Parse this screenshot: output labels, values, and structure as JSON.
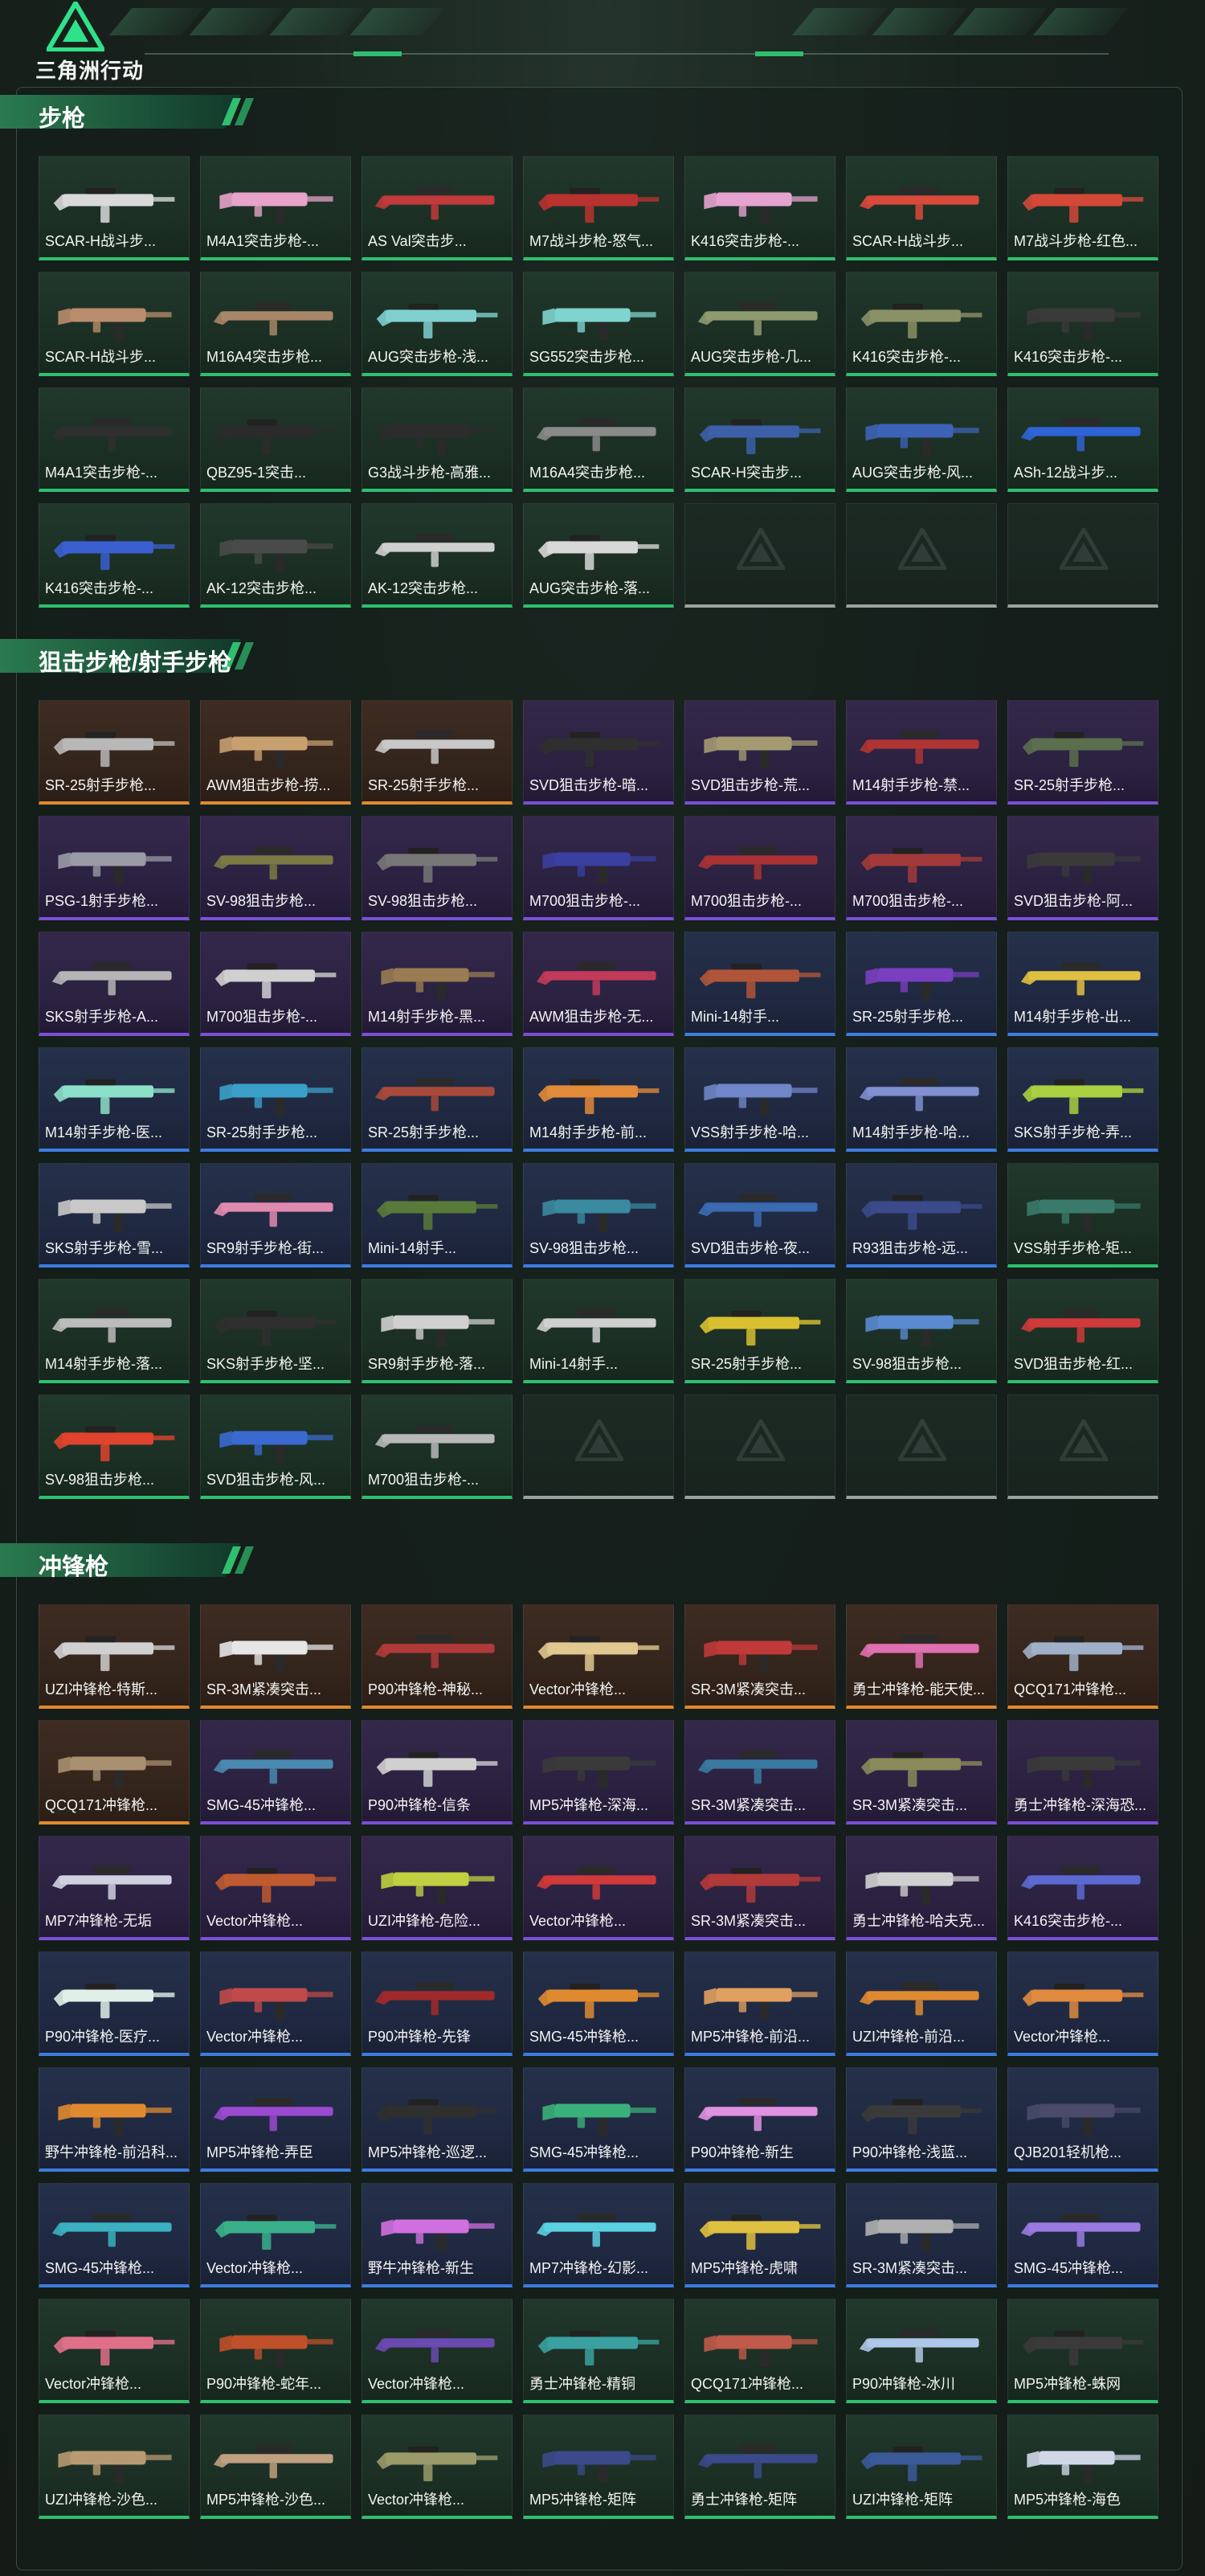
{
  "app": {
    "logo_text": "三角洲行动"
  },
  "colors": {
    "green": "#2fbf6e",
    "purple": "#7b4fd6",
    "orange": "#e08a2c",
    "blue": "#3c7de0",
    "empty": "#9aa3a0"
  },
  "sections": [
    {
      "title": "步枪",
      "items": [
        {
          "label": "SCAR-H战斗步...",
          "rarity": "green",
          "color": "#d9d9d9"
        },
        {
          "label": "M4A1突击步枪-...",
          "rarity": "green",
          "color": "#e7a3c9"
        },
        {
          "label": "AS Val突击步...",
          "rarity": "green",
          "color": "#c23a3a"
        },
        {
          "label": "M7战斗步枪-怒气...",
          "rarity": "green",
          "color": "#b8322f"
        },
        {
          "label": "K416突击步枪-...",
          "rarity": "green",
          "color": "#e6a3cf"
        },
        {
          "label": "SCAR-H战斗步...",
          "rarity": "green",
          "color": "#d94a3a"
        },
        {
          "label": "M7战斗步枪-红色...",
          "rarity": "green",
          "color": "#d44838"
        },
        {
          "label": "SCAR-H战斗步...",
          "rarity": "green",
          "color": "#b98d6c"
        },
        {
          "label": "M16A4突击步枪...",
          "rarity": "green",
          "color": "#a88667"
        },
        {
          "label": "AUG突击步枪-浅...",
          "rarity": "green",
          "color": "#7fd0cf"
        },
        {
          "label": "SG552突击步枪...",
          "rarity": "green",
          "color": "#7fd4cf"
        },
        {
          "label": "AUG突击步枪-几...",
          "rarity": "green",
          "color": "#8e9a6f"
        },
        {
          "label": "K416突击步枪-...",
          "rarity": "green",
          "color": "#8b9166"
        },
        {
          "label": "K416突击步枪-...",
          "rarity": "green",
          "color": "#3a3a3a"
        },
        {
          "label": "M4A1突击步枪-...",
          "rarity": "green",
          "color": "#2f2f2f"
        },
        {
          "label": "QBZ95-1突击...",
          "rarity": "green",
          "color": "#2b2b2b"
        },
        {
          "label": "G3战斗步枪-高雅...",
          "rarity": "green",
          "color": "#2c2c2c"
        },
        {
          "label": "M16A4突击步枪...",
          "rarity": "green",
          "color": "#8a8a8a"
        },
        {
          "label": "SCAR-H突击步...",
          "rarity": "green",
          "color": "#3d5fa8"
        },
        {
          "label": "AUG突击步枪-风...",
          "rarity": "green",
          "color": "#3d63b8"
        },
        {
          "label": "ASh-12战斗步...",
          "rarity": "green",
          "color": "#2f63d6"
        },
        {
          "label": "K416突击步枪-...",
          "rarity": "green",
          "color": "#3a5fd0"
        },
        {
          "label": "AK-12突击步枪...",
          "rarity": "green",
          "color": "#4a4a4a"
        },
        {
          "label": "AK-12突击步枪...",
          "rarity": "green",
          "color": "#cfcfcf"
        },
        {
          "label": "AUG突击步枪-落...",
          "rarity": "green",
          "color": "#d8d8d8"
        },
        {
          "label": "",
          "rarity": "empty",
          "color": ""
        },
        {
          "label": "",
          "rarity": "empty",
          "color": ""
        },
        {
          "label": "",
          "rarity": "empty",
          "color": ""
        }
      ]
    },
    {
      "title": "狙击步枪/射手步枪",
      "items": [
        {
          "label": "SR-25射手步枪...",
          "rarity": "orange",
          "color": "#b8b8b8"
        },
        {
          "label": "AWM狙击步枪-捞...",
          "rarity": "orange",
          "color": "#c8a070"
        },
        {
          "label": "SR-25射手步枪...",
          "rarity": "orange",
          "color": "#c8c8c8"
        },
        {
          "label": "SVD狙击步枪-暗...",
          "rarity": "purple",
          "color": "#2f2f2f"
        },
        {
          "label": "SVD狙击步枪-荒...",
          "rarity": "purple",
          "color": "#a49a72"
        },
        {
          "label": "M14射手步枪-禁...",
          "rarity": "purple",
          "color": "#b03434"
        },
        {
          "label": "SR-25射手步枪...",
          "rarity": "purple",
          "color": "#5b6e4e"
        },
        {
          "label": "PSG-1射手步枪...",
          "rarity": "purple",
          "color": "#9a9aa6"
        },
        {
          "label": "SV-98狙击步枪...",
          "rarity": "purple",
          "color": "#7b7a44"
        },
        {
          "label": "SV-98狙击步枪...",
          "rarity": "purple",
          "color": "#777777"
        },
        {
          "label": "M700狙击步枪-...",
          "rarity": "purple",
          "color": "#3a3fa0"
        },
        {
          "label": "M700狙击步枪-...",
          "rarity": "purple",
          "color": "#a83232"
        },
        {
          "label": "M700狙击步枪-...",
          "rarity": "purple",
          "color": "#a33a3a"
        },
        {
          "label": "SVD狙击步枪-阿...",
          "rarity": "purple",
          "color": "#3a3a3a"
        },
        {
          "label": "SKS射手步枪-A...",
          "rarity": "purple",
          "color": "#b5b5b5"
        },
        {
          "label": "M700狙击步枪-...",
          "rarity": "purple",
          "color": "#d0d0d0"
        },
        {
          "label": "M14射手步枪-黑...",
          "rarity": "purple",
          "color": "#9a7b52"
        },
        {
          "label": "AWM狙击步枪-无...",
          "rarity": "purple",
          "color": "#c23a5a"
        },
        {
          "label": "Mini-14射手...",
          "rarity": "blue",
          "color": "#b0553a"
        },
        {
          "label": "SR-25射手步枪...",
          "rarity": "blue",
          "color": "#7a3fc0"
        },
        {
          "label": "M14射手步枪-出...",
          "rarity": "blue",
          "color": "#e0c040"
        },
        {
          "label": "M14射手步枪-医...",
          "rarity": "blue",
          "color": "#8de0c8"
        },
        {
          "label": "SR-25射手步枪...",
          "rarity": "blue",
          "color": "#3aa0c8"
        },
        {
          "label": "SR-25射手步枪...",
          "rarity": "blue",
          "color": "#a84a3a"
        },
        {
          "label": "M14射手步枪-前...",
          "rarity": "blue",
          "color": "#e08a3a"
        },
        {
          "label": "VSS射手步枪-哈...",
          "rarity": "blue",
          "color": "#6f86c8"
        },
        {
          "label": "M14射手步枪-哈...",
          "rarity": "blue",
          "color": "#7f8fd0"
        },
        {
          "label": "SKS射手步枪-弄...",
          "rarity": "blue",
          "color": "#a8d040"
        },
        {
          "label": "SKS射手步枪-雪...",
          "rarity": "blue",
          "color": "#c8c8c8"
        },
        {
          "label": "SR9射手步枪-街...",
          "rarity": "blue",
          "color": "#e08ab0"
        },
        {
          "label": "Mini-14射手...",
          "rarity": "blue",
          "color": "#5a7a3a"
        },
        {
          "label": "SV-98狙击步枪...",
          "rarity": "blue",
          "color": "#3a8aa0"
        },
        {
          "label": "SVD狙击步枪-夜...",
          "rarity": "blue",
          "color": "#3a6ab0"
        },
        {
          "label": "R93狙击步枪-远...",
          "rarity": "blue",
          "color": "#3a4a8a"
        },
        {
          "label": "VSS射手步枪-矩...",
          "rarity": "green",
          "color": "#3a7a6a"
        },
        {
          "label": "M14射手步枪-落...",
          "rarity": "green",
          "color": "#bcbcbc"
        },
        {
          "label": "SKS射手步枪-坚...",
          "rarity": "green",
          "color": "#2f2f2f"
        },
        {
          "label": "SR9射手步枪-落...",
          "rarity": "green",
          "color": "#d0d0d0"
        },
        {
          "label": "Mini-14射手...",
          "rarity": "green",
          "color": "#cfcfcf"
        },
        {
          "label": "SR-25射手步枪...",
          "rarity": "green",
          "color": "#d8c030"
        },
        {
          "label": "SV-98狙击步枪...",
          "rarity": "green",
          "color": "#5a8ad0"
        },
        {
          "label": "SVD狙击步枪-红...",
          "rarity": "green",
          "color": "#d03a3a"
        },
        {
          "label": "SV-98狙击步枪...",
          "rarity": "green",
          "color": "#e0442e"
        },
        {
          "label": "SVD狙击步枪-风...",
          "rarity": "green",
          "color": "#3a6ad0"
        },
        {
          "label": "M700狙击步枪-...",
          "rarity": "green",
          "color": "#b8b8b8"
        },
        {
          "label": "",
          "rarity": "empty",
          "color": ""
        },
        {
          "label": "",
          "rarity": "empty",
          "color": ""
        },
        {
          "label": "",
          "rarity": "empty",
          "color": ""
        },
        {
          "label": "",
          "rarity": "empty",
          "color": ""
        }
      ]
    },
    {
      "title": "冲锋枪",
      "items": [
        {
          "label": "UZI冲锋枪-特斯...",
          "rarity": "orange",
          "color": "#d0d0d0"
        },
        {
          "label": "SR-3M紧凑突击...",
          "rarity": "orange",
          "color": "#e6e6e6"
        },
        {
          "label": "P90冲锋枪-神秘...",
          "rarity": "orange",
          "color": "#b03a3a"
        },
        {
          "label": "Vector冲锋枪...",
          "rarity": "orange",
          "color": "#e0c890"
        },
        {
          "label": "SR-3M紧凑突击...",
          "rarity": "orange",
          "color": "#c03a3a"
        },
        {
          "label": "勇士冲锋枪-能天使...",
          "rarity": "orange",
          "color": "#e070b0"
        },
        {
          "label": "QCQ171冲锋枪...",
          "rarity": "orange",
          "color": "#a0b0c8"
        },
        {
          "label": "QCQ171冲锋枪...",
          "rarity": "orange",
          "color": "#a89070"
        },
        {
          "label": "SMG-45冲锋枪...",
          "rarity": "purple",
          "color": "#4a8ab0"
        },
        {
          "label": "P90冲锋枪-信条",
          "rarity": "purple",
          "color": "#d0d0d0"
        },
        {
          "label": "MP5冲锋枪-深海...",
          "rarity": "purple",
          "color": "#3a3a3a"
        },
        {
          "label": "SR-3M紧凑突击...",
          "rarity": "purple",
          "color": "#3a7aa0"
        },
        {
          "label": "SR-3M紧凑突击...",
          "rarity": "purple",
          "color": "#8a8a5a"
        },
        {
          "label": "勇士冲锋枪-深海恐...",
          "rarity": "purple",
          "color": "#3a3a3a"
        },
        {
          "label": "MP7冲锋枪-无垢",
          "rarity": "purple",
          "color": "#d0d0e0"
        },
        {
          "label": "Vector冲锋枪...",
          "rarity": "purple",
          "color": "#c05a30"
        },
        {
          "label": "UZI冲锋枪-危险...",
          "rarity": "purple",
          "color": "#c0d040"
        },
        {
          "label": "Vector冲锋枪...",
          "rarity": "purple",
          "color": "#d03a3a"
        },
        {
          "label": "SR-3M紧凑突击...",
          "rarity": "purple",
          "color": "#b03a3a"
        },
        {
          "label": "勇士冲锋枪-哈夫克...",
          "rarity": "purple",
          "color": "#d0d0d0"
        },
        {
          "label": "K416突击步枪-...",
          "rarity": "purple",
          "color": "#5a6ad0"
        },
        {
          "label": "P90冲锋枪-医疗...",
          "rarity": "blue",
          "color": "#e0f0e8"
        },
        {
          "label": "Vector冲锋枪...",
          "rarity": "blue",
          "color": "#c04a4a"
        },
        {
          "label": "P90冲锋枪-先锋",
          "rarity": "blue",
          "color": "#a02a2a"
        },
        {
          "label": "SMG-45冲锋枪...",
          "rarity": "blue",
          "color": "#e08a30"
        },
        {
          "label": "MP5冲锋枪-前沿...",
          "rarity": "blue",
          "color": "#e0a060"
        },
        {
          "label": "UZI冲锋枪-前沿...",
          "rarity": "blue",
          "color": "#e08a30"
        },
        {
          "label": "Vector冲锋枪...",
          "rarity": "blue",
          "color": "#e08a40"
        },
        {
          "label": "野牛冲锋枪-前沿科...",
          "rarity": "blue",
          "color": "#e08a30"
        },
        {
          "label": "MP5冲锋枪-弄臣",
          "rarity": "blue",
          "color": "#9a4ad0"
        },
        {
          "label": "MP5冲锋枪-巡逻...",
          "rarity": "blue",
          "color": "#2f2f2f"
        },
        {
          "label": "SMG-45冲锋枪...",
          "rarity": "blue",
          "color": "#3ab07a"
        },
        {
          "label": "P90冲锋枪-新生",
          "rarity": "blue",
          "color": "#e090e0"
        },
        {
          "label": "P90冲锋枪-浅蓝...",
          "rarity": "blue",
          "color": "#3a3a3a"
        },
        {
          "label": "QJB201轻机枪...",
          "rarity": "blue",
          "color": "#4a4a6a"
        },
        {
          "label": "SMG-45冲锋枪...",
          "rarity": "blue",
          "color": "#3ab0c0"
        },
        {
          "label": "Vector冲锋枪...",
          "rarity": "blue",
          "color": "#3ab08a"
        },
        {
          "label": "野牛冲锋枪-新生",
          "rarity": "blue",
          "color": "#d070e0"
        },
        {
          "label": "MP7冲锋枪-幻影...",
          "rarity": "blue",
          "color": "#5ad0e0"
        },
        {
          "label": "MP5冲锋枪-虎啸",
          "rarity": "blue",
          "color": "#e0c040"
        },
        {
          "label": "SR-3M紧凑突击...",
          "rarity": "blue",
          "color": "#b0b0b0"
        },
        {
          "label": "SMG-45冲锋枪...",
          "rarity": "blue",
          "color": "#9a7ae0"
        },
        {
          "label": "Vector冲锋枪...",
          "rarity": "green",
          "color": "#e0708a"
        },
        {
          "label": "P90冲锋枪-蛇年...",
          "rarity": "green",
          "color": "#c0502a"
        },
        {
          "label": "Vector冲锋枪...",
          "rarity": "green",
          "color": "#6a4ab0"
        },
        {
          "label": "勇士冲锋枪-精铜",
          "rarity": "green",
          "color": "#3aa0a0"
        },
        {
          "label": "QCQ171冲锋枪...",
          "rarity": "green",
          "color": "#c05a4a"
        },
        {
          "label": "P90冲锋枪-冰川",
          "rarity": "green",
          "color": "#b0c8e8"
        },
        {
          "label": "MP5冲锋枪-蛛网",
          "rarity": "green",
          "color": "#3a3a3a"
        },
        {
          "label": "UZI冲锋枪-沙色...",
          "rarity": "green",
          "color": "#b89a72"
        },
        {
          "label": "MP5冲锋枪-沙色...",
          "rarity": "green",
          "color": "#c0a080"
        },
        {
          "label": "Vector冲锋枪...",
          "rarity": "green",
          "color": "#9a9a6a"
        },
        {
          "label": "MP5冲锋枪-矩阵",
          "rarity": "green",
          "color": "#3a4a8a"
        },
        {
          "label": "勇士冲锋枪-矩阵",
          "rarity": "green",
          "color": "#3a4a8a"
        },
        {
          "label": "UZI冲锋枪-矩阵",
          "rarity": "green",
          "color": "#3a5a9a"
        },
        {
          "label": "MP5冲锋枪-海色",
          "rarity": "green",
          "color": "#d0d8e8"
        }
      ]
    }
  ]
}
